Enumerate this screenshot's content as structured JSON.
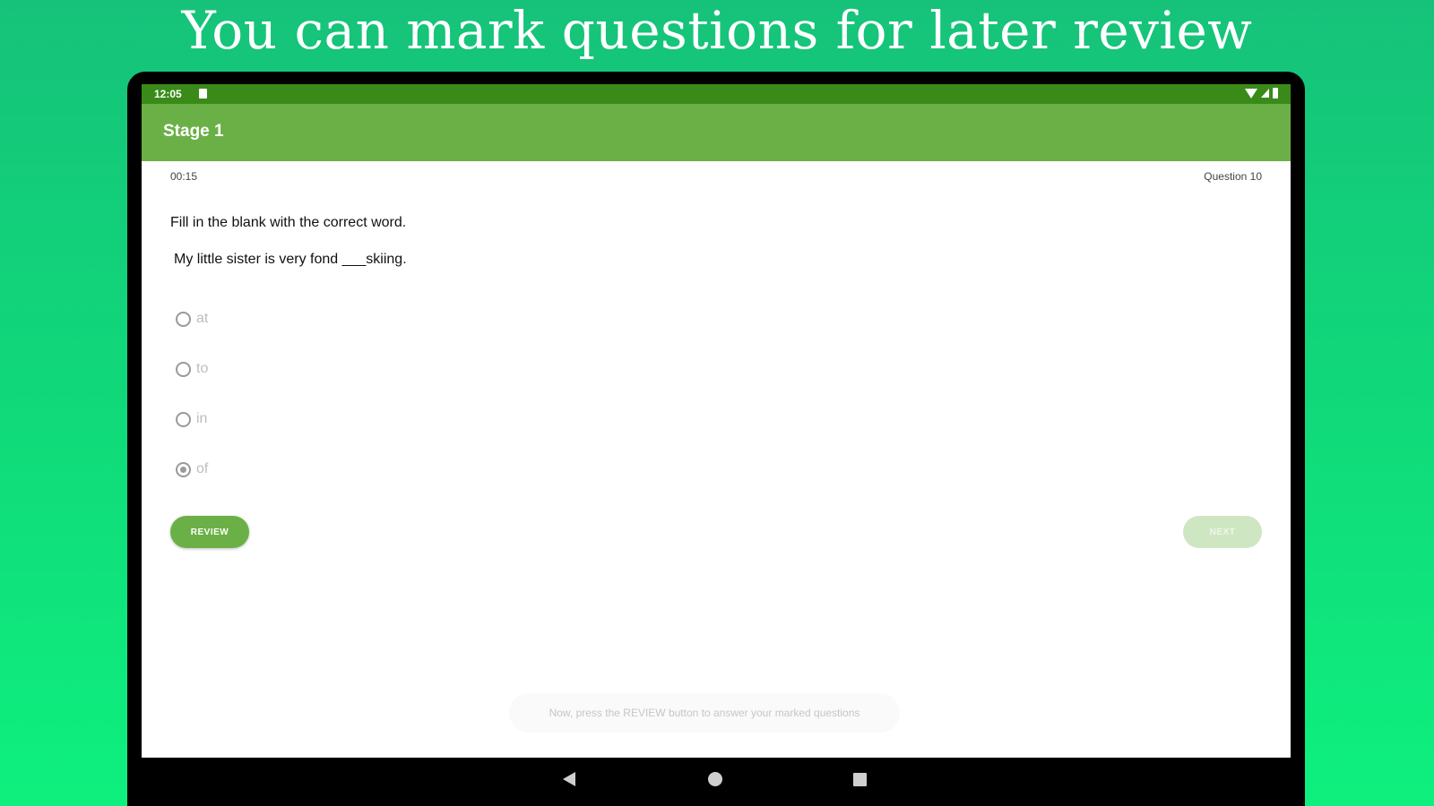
{
  "headline": "You can mark questions for later review",
  "status_bar": {
    "time": "12:05"
  },
  "app_bar": {
    "title": "Stage 1"
  },
  "quiz": {
    "timer": "00:15",
    "question_counter": "Question 10",
    "instruction": "Fill in the blank with the correct word.",
    "question": "My little sister is very fond ___skiing.",
    "options": [
      {
        "label": "at",
        "selected": false
      },
      {
        "label": "to",
        "selected": false
      },
      {
        "label": "in",
        "selected": false
      },
      {
        "label": "of",
        "selected": true
      }
    ],
    "review_label": "REVIEW",
    "next_label": "NEXT"
  },
  "toast": "Now, press the REVIEW button to answer your marked questions",
  "colors": {
    "background_top": "#16c27a",
    "background_bottom": "#0ef07e",
    "status_bar": "#3a8a1a",
    "app_bar": "#6bb046",
    "next_disabled": "#cfe6c2"
  },
  "icons": {
    "status_sd": "sd-card-icon",
    "status_wifi": "wifi-icon",
    "status_signal": "signal-icon",
    "status_battery": "battery-icon",
    "nav_back": "back-triangle-icon",
    "nav_home": "home-circle-icon",
    "nav_recents": "recents-square-icon"
  }
}
